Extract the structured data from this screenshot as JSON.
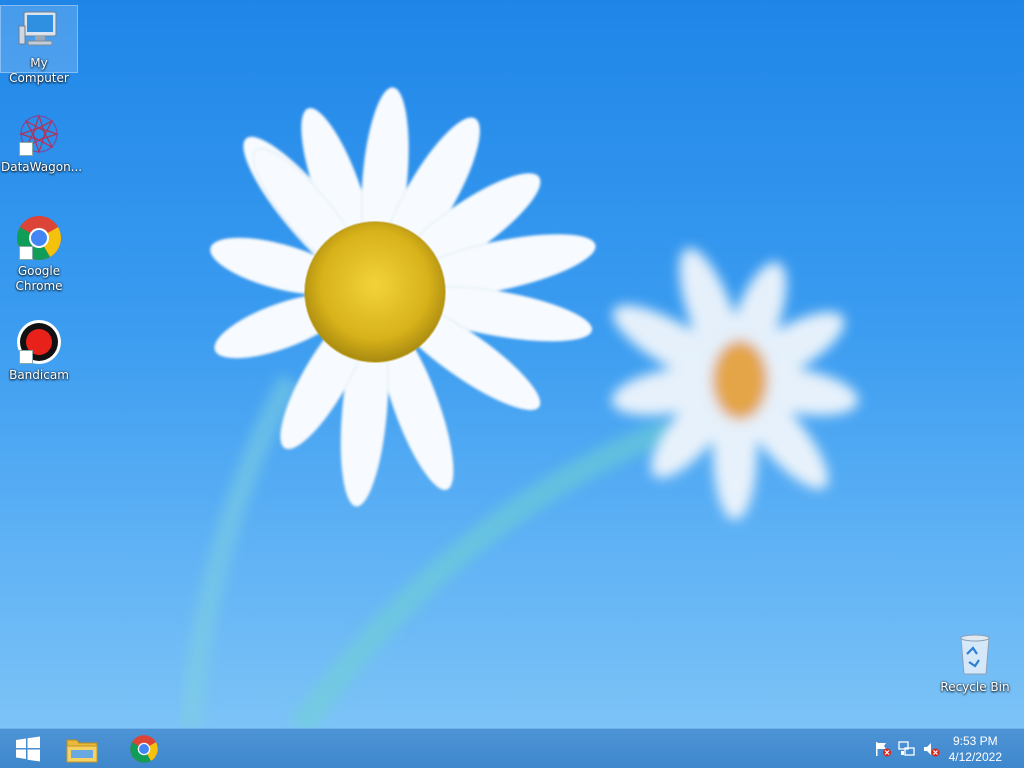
{
  "desktop": {
    "icons": [
      {
        "label": "My Computer",
        "icon": "computer-icon"
      },
      {
        "label": "DataWagon...",
        "icon": "datawagon-icon"
      },
      {
        "label": "Google Chrome",
        "icon": "chrome-icon"
      },
      {
        "label": "Bandicam",
        "icon": "bandicam-icon"
      },
      {
        "label": "Recycle Bin",
        "icon": "recycle-bin-icon"
      }
    ]
  },
  "taskbar": {
    "pinned": [
      {
        "name": "start",
        "icon": "windows-logo-icon"
      },
      {
        "name": "file-explorer",
        "icon": "file-explorer-icon"
      },
      {
        "name": "chrome",
        "icon": "chrome-icon"
      }
    ],
    "tray": {
      "icons": [
        "action-center-flag-icon",
        "network-icon",
        "volume-muted-icon"
      ],
      "time": "9:53 PM",
      "date": "4/12/2022"
    }
  },
  "colors": {
    "desktop_top": "#1f86e8",
    "desktop_bottom": "#7cc3f7",
    "taskbar": "#4489cf"
  }
}
